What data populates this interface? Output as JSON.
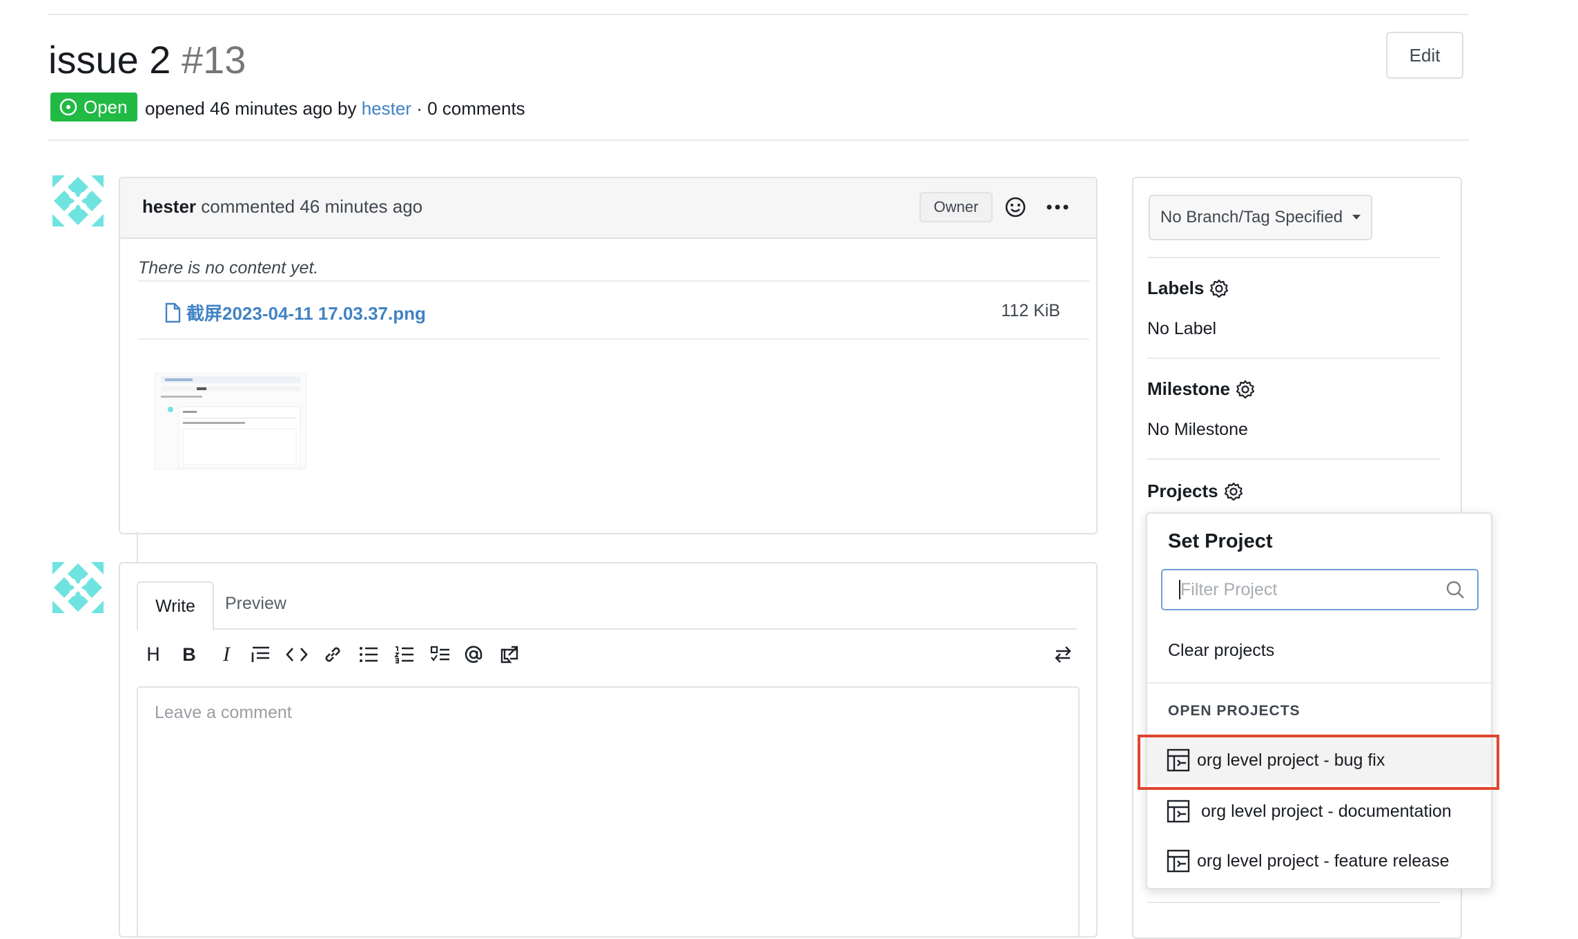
{
  "issue": {
    "title": "issue 2",
    "number": "#13",
    "edit_label": "Edit",
    "status_label": "Open",
    "meta_prefix": "opened 46 minutes ago by",
    "author": "hester",
    "meta_suffix": "· 0 comments"
  },
  "comment": {
    "author": "hester",
    "action": "commented 46 minutes ago",
    "role_badge": "Owner",
    "empty_text": "There is no content yet.",
    "attachment_name": "截屏2023-04-11 17.03.37.png",
    "attachment_size": "112 KiB"
  },
  "editor": {
    "tab_write": "Write",
    "tab_preview": "Preview",
    "placeholder": "Leave a comment",
    "toolbar": {
      "heading": "H",
      "bold": "B",
      "italic": "I"
    }
  },
  "sidebar": {
    "branch_label": "No Branch/Tag Specified",
    "labels_heading": "Labels",
    "labels_value": "No Label",
    "milestone_heading": "Milestone",
    "milestone_value": "No Milestone",
    "projects_heading": "Projects"
  },
  "project_popup": {
    "title": "Set Project",
    "filter_placeholder": "Filter Project",
    "clear_label": "Clear projects",
    "section_label": "OPEN PROJECTS",
    "items": [
      {
        "label": "org level project - bug fix"
      },
      {
        "label": "org level project - documentation"
      },
      {
        "label": "org level project - feature release"
      }
    ]
  },
  "colors": {
    "open_green": "#21ba45",
    "link_blue": "#4183c4",
    "highlight_red": "#e0452f",
    "avatar_teal": "#6fe3e0"
  }
}
